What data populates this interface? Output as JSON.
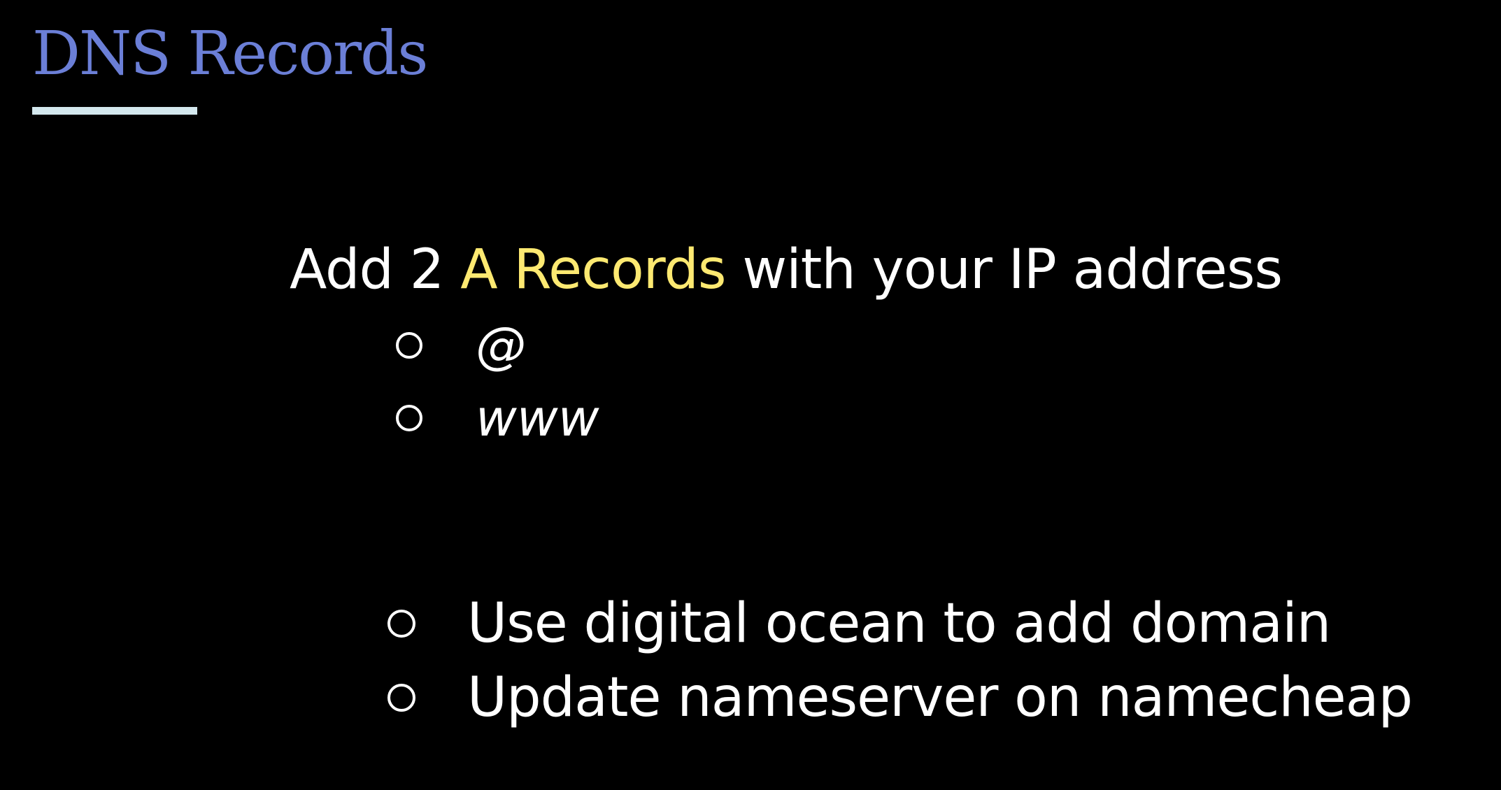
{
  "slide": {
    "title": "DNS Records",
    "title_color": "#6b7fd7",
    "underline_color": "#d4e8ee",
    "headline": {
      "prefix": "Add 2 ",
      "highlight": "A Records",
      "suffix": " with your IP address",
      "highlight_color": "#fde971"
    },
    "record_list": [
      {
        "label": "@"
      },
      {
        "label": "www"
      }
    ],
    "steps": [
      {
        "label": "Use digital ocean to add domain"
      },
      {
        "label": "Update nameserver on namecheap"
      }
    ]
  }
}
